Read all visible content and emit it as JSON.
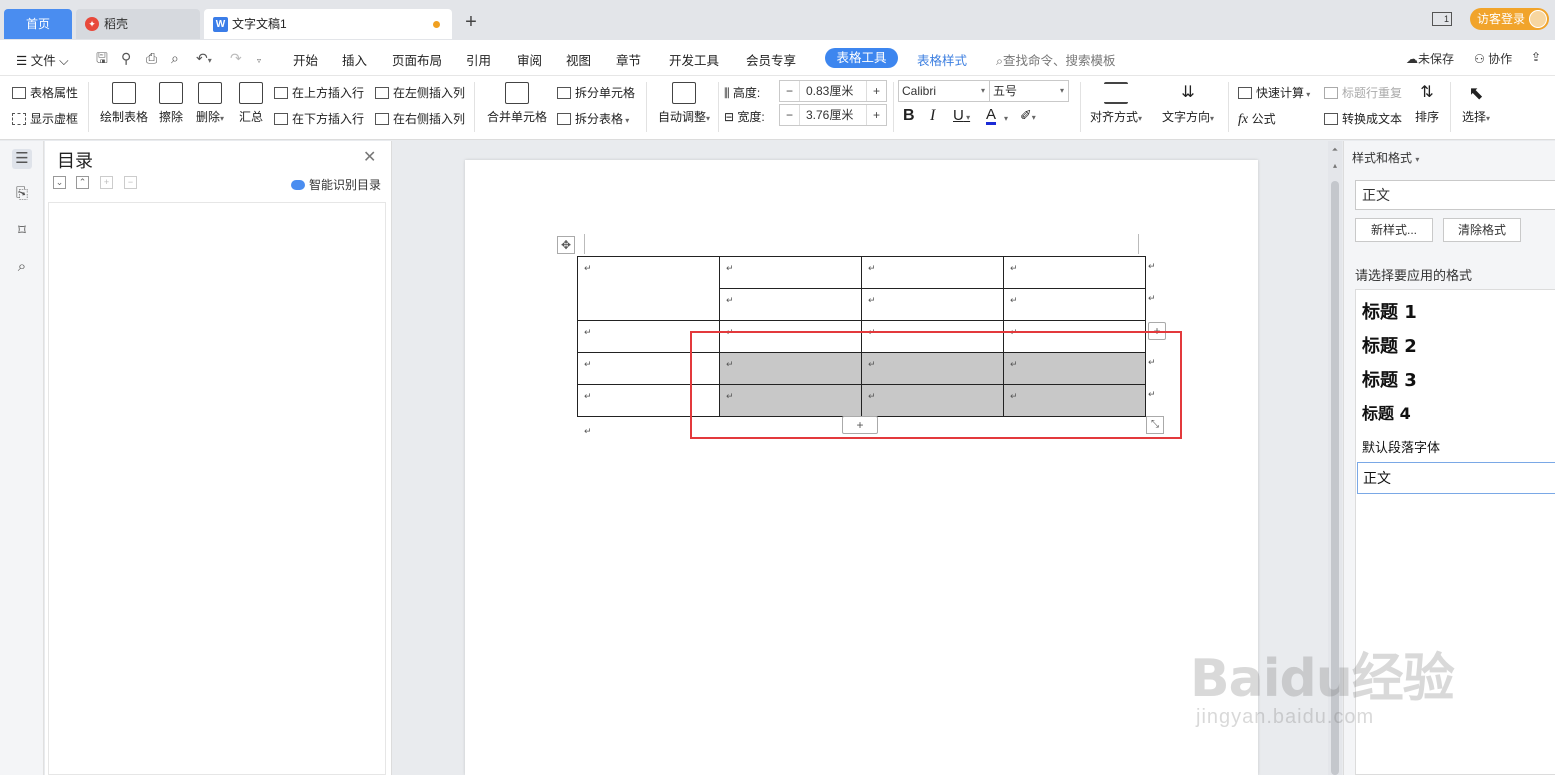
{
  "tabs": {
    "home": "首页",
    "docer": "稻壳",
    "doc": "文字文稿1",
    "login": "访客登录"
  },
  "menu": {
    "file": "文件",
    "items": [
      "开始",
      "插入",
      "页面布局",
      "引用",
      "审阅",
      "视图",
      "章节",
      "开发工具",
      "会员专享"
    ],
    "table_tools": "表格工具",
    "table_style": "表格样式",
    "search": "查找命令、搜索模板",
    "unsaved": "未保存",
    "collab": "协作"
  },
  "ribbon": {
    "table_props": "表格属性",
    "show_grid": "显示虚框",
    "draw_table": "绘制表格",
    "erase": "擦除",
    "delete": "删除",
    "summary": "汇总",
    "insert_above": "在上方插入行",
    "insert_below": "在下方插入行",
    "insert_left": "在左侧插入列",
    "insert_right": "在右侧插入列",
    "merge_cells": "合并单元格",
    "split_cells": "拆分单元格",
    "split_table": "拆分表格",
    "auto_fit": "自动调整",
    "height_label": "高度:",
    "height_value": "0.83厘米",
    "width_label": "宽度:",
    "width_value": "3.76厘米",
    "font": "Calibri",
    "font_size": "五号",
    "align": "对齐方式",
    "text_dir": "文字方向",
    "quick_calc": "快速计算",
    "formula": "公式",
    "repeat_header": "标题行重复",
    "to_text": "转换成文本",
    "sort": "排序",
    "select": "选择"
  },
  "toc": {
    "title": "目录",
    "smart": "智能识别目录"
  },
  "styles_pane": {
    "title": "样式和格式",
    "current": "正文",
    "new_style": "新样式...",
    "clear_format": "清除格式",
    "choose_label": "请选择要应用的格式",
    "items": [
      "标题  1",
      "标题  2",
      "标题  3",
      "标题  4",
      "默认段落字体",
      "正文"
    ]
  },
  "document": {
    "para_mark": "↵",
    "rows": 5,
    "cols": 4,
    "selected_cells": [
      [
        3,
        1
      ],
      [
        3,
        2
      ],
      [
        3,
        3
      ],
      [
        4,
        1
      ],
      [
        4,
        2
      ],
      [
        4,
        3
      ]
    ]
  },
  "watermark": {
    "main": "Baidu经验",
    "sub": "jingyan.baidu.com"
  },
  "colors": {
    "accent": "#3d86ef",
    "highlight": "#e3393c",
    "selection": "#c8c8c8",
    "login": "#f1a42b"
  }
}
